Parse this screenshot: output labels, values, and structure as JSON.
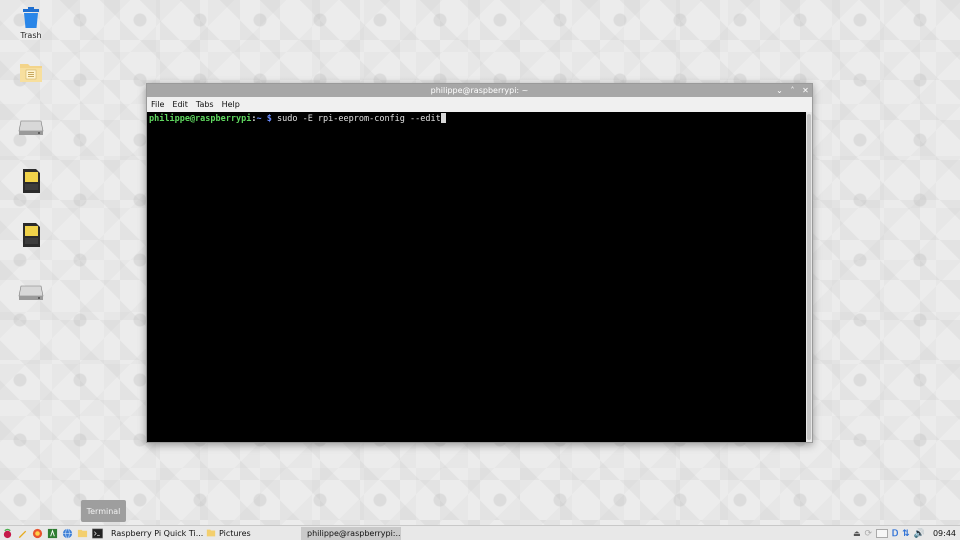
{
  "desktop": {
    "icons": [
      {
        "label": "Trash"
      }
    ]
  },
  "window": {
    "title": "philippe@raspberrypi: ~",
    "menu": [
      "File",
      "Edit",
      "Tabs",
      "Help"
    ],
    "terminal": {
      "user_host": "philippe@raspberrypi",
      "separator": ":",
      "path": "~",
      "prompt": "$",
      "command": "sudo -E rpi-eeprom-config --edit"
    }
  },
  "tooltip": {
    "text": "Terminal"
  },
  "taskbar": {
    "tasks": [
      {
        "label": "Raspberry Pi Quick Ti..."
      },
      {
        "label": "Pictures"
      },
      {
        "label": "philippe@raspberrypi:..."
      }
    ],
    "clock": "09:44"
  },
  "colors": {
    "prompt_user": "#5fd75f",
    "prompt_path": "#6b8cff",
    "titlebar": "#a7a7a7",
    "raspberry": "#c51a4a"
  }
}
